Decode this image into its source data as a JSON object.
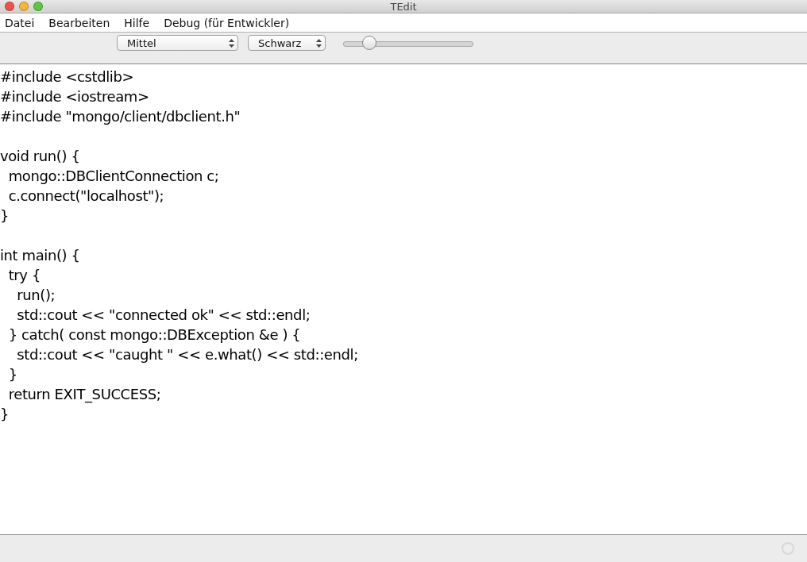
{
  "window": {
    "title": "TEdit"
  },
  "menu": [
    "Datei",
    "Bearbeiten",
    "Hilfe",
    "Debug (für Entwickler)"
  ],
  "toolbar": {
    "size_select": {
      "value": "Mittel"
    },
    "color_select": {
      "value": "Schwarz"
    },
    "slider": {
      "level": 0.2
    }
  },
  "editor": {
    "blocks": [
      [
        "#include <cstdlib>",
        "#include <iostream>",
        "#include \"mongo/client/dbclient.h\""
      ],
      [
        "void run() {",
        "  mongo::DBClientConnection c;",
        "  c.connect(\"localhost\");",
        "}"
      ],
      [
        "int main() {",
        "  try {",
        "    run();",
        "    std::cout << \"connected ok\" << std::endl;",
        "  } catch( const mongo::DBException &e ) {",
        "    std::cout << \"caught \" << e.what() << std::endl;",
        "  }",
        "  return EXIT_SUCCESS;",
        "}"
      ]
    ]
  }
}
